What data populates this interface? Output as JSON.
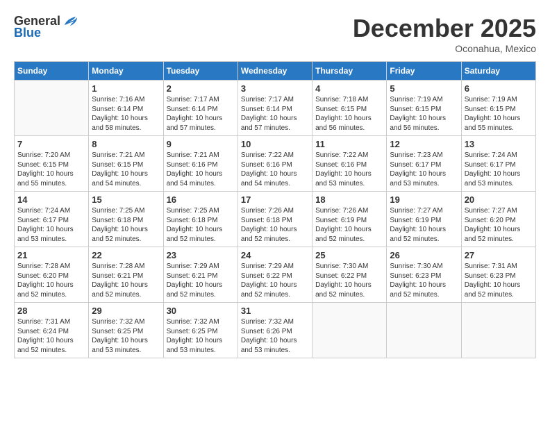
{
  "logo": {
    "general": "General",
    "blue": "Blue"
  },
  "title": "December 2025",
  "location": "Oconahua, Mexico",
  "days_of_week": [
    "Sunday",
    "Monday",
    "Tuesday",
    "Wednesday",
    "Thursday",
    "Friday",
    "Saturday"
  ],
  "weeks": [
    [
      {
        "day": "",
        "info": ""
      },
      {
        "day": "1",
        "info": "Sunrise: 7:16 AM\nSunset: 6:14 PM\nDaylight: 10 hours\nand 58 minutes."
      },
      {
        "day": "2",
        "info": "Sunrise: 7:17 AM\nSunset: 6:14 PM\nDaylight: 10 hours\nand 57 minutes."
      },
      {
        "day": "3",
        "info": "Sunrise: 7:17 AM\nSunset: 6:14 PM\nDaylight: 10 hours\nand 57 minutes."
      },
      {
        "day": "4",
        "info": "Sunrise: 7:18 AM\nSunset: 6:15 PM\nDaylight: 10 hours\nand 56 minutes."
      },
      {
        "day": "5",
        "info": "Sunrise: 7:19 AM\nSunset: 6:15 PM\nDaylight: 10 hours\nand 56 minutes."
      },
      {
        "day": "6",
        "info": "Sunrise: 7:19 AM\nSunset: 6:15 PM\nDaylight: 10 hours\nand 55 minutes."
      }
    ],
    [
      {
        "day": "7",
        "info": "Sunrise: 7:20 AM\nSunset: 6:15 PM\nDaylight: 10 hours\nand 55 minutes."
      },
      {
        "day": "8",
        "info": "Sunrise: 7:21 AM\nSunset: 6:15 PM\nDaylight: 10 hours\nand 54 minutes."
      },
      {
        "day": "9",
        "info": "Sunrise: 7:21 AM\nSunset: 6:16 PM\nDaylight: 10 hours\nand 54 minutes."
      },
      {
        "day": "10",
        "info": "Sunrise: 7:22 AM\nSunset: 6:16 PM\nDaylight: 10 hours\nand 54 minutes."
      },
      {
        "day": "11",
        "info": "Sunrise: 7:22 AM\nSunset: 6:16 PM\nDaylight: 10 hours\nand 53 minutes."
      },
      {
        "day": "12",
        "info": "Sunrise: 7:23 AM\nSunset: 6:17 PM\nDaylight: 10 hours\nand 53 minutes."
      },
      {
        "day": "13",
        "info": "Sunrise: 7:24 AM\nSunset: 6:17 PM\nDaylight: 10 hours\nand 53 minutes."
      }
    ],
    [
      {
        "day": "14",
        "info": "Sunrise: 7:24 AM\nSunset: 6:17 PM\nDaylight: 10 hours\nand 53 minutes."
      },
      {
        "day": "15",
        "info": "Sunrise: 7:25 AM\nSunset: 6:18 PM\nDaylight: 10 hours\nand 52 minutes."
      },
      {
        "day": "16",
        "info": "Sunrise: 7:25 AM\nSunset: 6:18 PM\nDaylight: 10 hours\nand 52 minutes."
      },
      {
        "day": "17",
        "info": "Sunrise: 7:26 AM\nSunset: 6:18 PM\nDaylight: 10 hours\nand 52 minutes."
      },
      {
        "day": "18",
        "info": "Sunrise: 7:26 AM\nSunset: 6:19 PM\nDaylight: 10 hours\nand 52 minutes."
      },
      {
        "day": "19",
        "info": "Sunrise: 7:27 AM\nSunset: 6:19 PM\nDaylight: 10 hours\nand 52 minutes."
      },
      {
        "day": "20",
        "info": "Sunrise: 7:27 AM\nSunset: 6:20 PM\nDaylight: 10 hours\nand 52 minutes."
      }
    ],
    [
      {
        "day": "21",
        "info": "Sunrise: 7:28 AM\nSunset: 6:20 PM\nDaylight: 10 hours\nand 52 minutes."
      },
      {
        "day": "22",
        "info": "Sunrise: 7:28 AM\nSunset: 6:21 PM\nDaylight: 10 hours\nand 52 minutes."
      },
      {
        "day": "23",
        "info": "Sunrise: 7:29 AM\nSunset: 6:21 PM\nDaylight: 10 hours\nand 52 minutes."
      },
      {
        "day": "24",
        "info": "Sunrise: 7:29 AM\nSunset: 6:22 PM\nDaylight: 10 hours\nand 52 minutes."
      },
      {
        "day": "25",
        "info": "Sunrise: 7:30 AM\nSunset: 6:22 PM\nDaylight: 10 hours\nand 52 minutes."
      },
      {
        "day": "26",
        "info": "Sunrise: 7:30 AM\nSunset: 6:23 PM\nDaylight: 10 hours\nand 52 minutes."
      },
      {
        "day": "27",
        "info": "Sunrise: 7:31 AM\nSunset: 6:23 PM\nDaylight: 10 hours\nand 52 minutes."
      }
    ],
    [
      {
        "day": "28",
        "info": "Sunrise: 7:31 AM\nSunset: 6:24 PM\nDaylight: 10 hours\nand 52 minutes."
      },
      {
        "day": "29",
        "info": "Sunrise: 7:32 AM\nSunset: 6:25 PM\nDaylight: 10 hours\nand 53 minutes."
      },
      {
        "day": "30",
        "info": "Sunrise: 7:32 AM\nSunset: 6:25 PM\nDaylight: 10 hours\nand 53 minutes."
      },
      {
        "day": "31",
        "info": "Sunrise: 7:32 AM\nSunset: 6:26 PM\nDaylight: 10 hours\nand 53 minutes."
      },
      {
        "day": "",
        "info": ""
      },
      {
        "day": "",
        "info": ""
      },
      {
        "day": "",
        "info": ""
      }
    ]
  ]
}
